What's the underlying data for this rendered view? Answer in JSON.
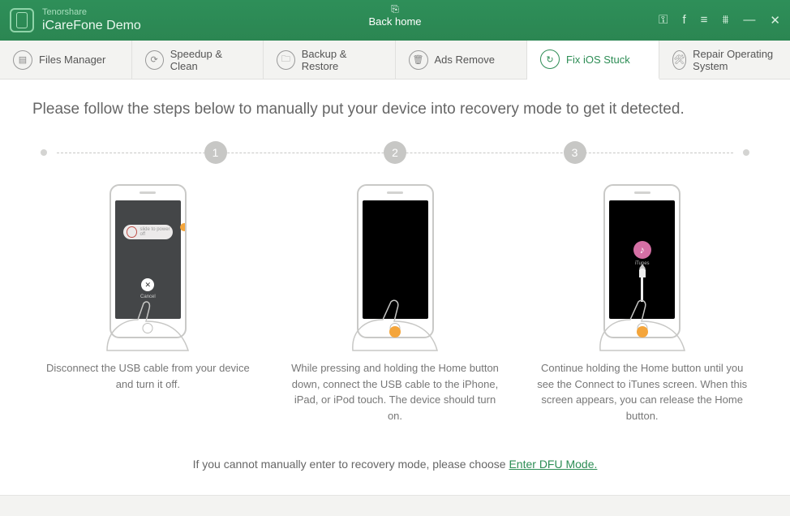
{
  "header": {
    "brand": "Tenorshare",
    "title": "iCareFone Demo",
    "back_label": "Back home",
    "controls": {
      "key": "⚿",
      "facebook": "f",
      "menu": "≡",
      "cart": "⩩",
      "minimize": "—",
      "close": "✕"
    }
  },
  "tabs": [
    {
      "label": "Files Manager",
      "icon": "files-icon"
    },
    {
      "label": "Speedup & Clean",
      "icon": "speedup-icon"
    },
    {
      "label": "Backup & Restore",
      "icon": "backup-icon"
    },
    {
      "label": "Ads Remove",
      "icon": "ads-icon"
    },
    {
      "label": "Fix iOS Stuck",
      "icon": "fix-icon",
      "active": true
    },
    {
      "label": "Repair Operating System",
      "icon": "repair-icon"
    }
  ],
  "content": {
    "heading": "Please follow the steps below to manually put your device into recovery mode to get it detected.",
    "step_numbers": [
      "1",
      "2",
      "3"
    ],
    "steps": [
      "Disconnect the USB cable from your device and turn it off.",
      "While pressing and holding the Home button down, connect the USB cable to the iPhone, iPad, or iPod touch. The device should turn on.",
      "Continue holding the Home button until you see the Connect to iTunes screen. When this screen appears, you can release the Home button."
    ],
    "slide_label": "slide to power off",
    "cancel_label": "Cancel",
    "itunes_label": "iTunes"
  },
  "footer": {
    "text": "If you cannot manually enter to recovery mode, please choose ",
    "link": "Enter DFU Mode."
  }
}
